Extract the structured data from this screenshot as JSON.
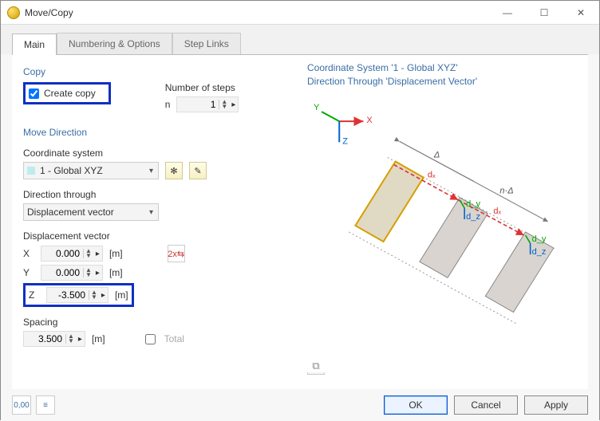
{
  "window": {
    "title": "Move/Copy",
    "min": "—",
    "max": "☐",
    "close": "✕"
  },
  "tabs": {
    "main": "Main",
    "numbering": "Numbering & Options",
    "steplinks": "Step Links"
  },
  "copy": {
    "group": "Copy",
    "create_copy": "Create copy",
    "num_steps_label": "Number of steps",
    "n_label": "n",
    "n_value": "1"
  },
  "move": {
    "group": "Move Direction",
    "coord_label": "Coordinate system",
    "coord_value": "1 - Global XYZ",
    "dir_label": "Direction through",
    "dir_value": "Displacement vector",
    "vec_label": "Displacement vector",
    "x": "X",
    "x_val": "0.000",
    "y": "Y",
    "y_val": "0.000",
    "z": "Z",
    "z_val": "-3.500",
    "unit": "[m]",
    "spacing_label": "Spacing",
    "spacing_val": "3.500",
    "total": "Total"
  },
  "preview": {
    "line1": "Coordinate System '1 - Global XYZ'",
    "line2": "Direction Through 'Displacement Vector'"
  },
  "buttons": {
    "ok": "OK",
    "cancel": "Cancel",
    "apply": "Apply"
  }
}
